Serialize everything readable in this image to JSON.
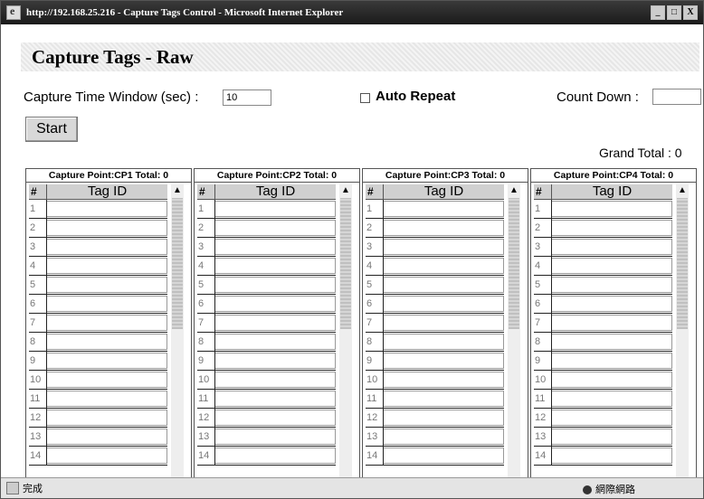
{
  "window": {
    "title": "http://192.168.25.216 - Capture Tags Control - Microsoft Internet Explorer",
    "min_label": "_",
    "max_label": "□",
    "close_label": "X"
  },
  "page": {
    "heading": "Capture Tags  -  Raw",
    "capture_window_label": "Capture Time Window (sec) :",
    "capture_window_value": "10",
    "auto_repeat_label": "Auto Repeat",
    "count_down_label": "Count Down :",
    "count_down_value": "",
    "start_label": "Start",
    "grand_total": "Grand Total : 0"
  },
  "panels": [
    {
      "title": "Capture Point:CP1 Total: 0",
      "num_header": "#",
      "tag_header": "Tag ID"
    },
    {
      "title": "Capture Point:CP2 Total: 0",
      "num_header": "#",
      "tag_header": "Tag ID"
    },
    {
      "title": "Capture Point:CP3 Total: 0",
      "num_header": "#",
      "tag_header": "Tag ID"
    },
    {
      "title": "Capture Point:CP4 Total: 0",
      "num_header": "#",
      "tag_header": "Tag ID"
    }
  ],
  "row_numbers": [
    "1",
    "2",
    "3",
    "4",
    "5",
    "6",
    "7",
    "8",
    "9",
    "10",
    "11",
    "12",
    "13",
    "14"
  ],
  "statusbar": {
    "left": "完成",
    "zone": "網際網路"
  }
}
